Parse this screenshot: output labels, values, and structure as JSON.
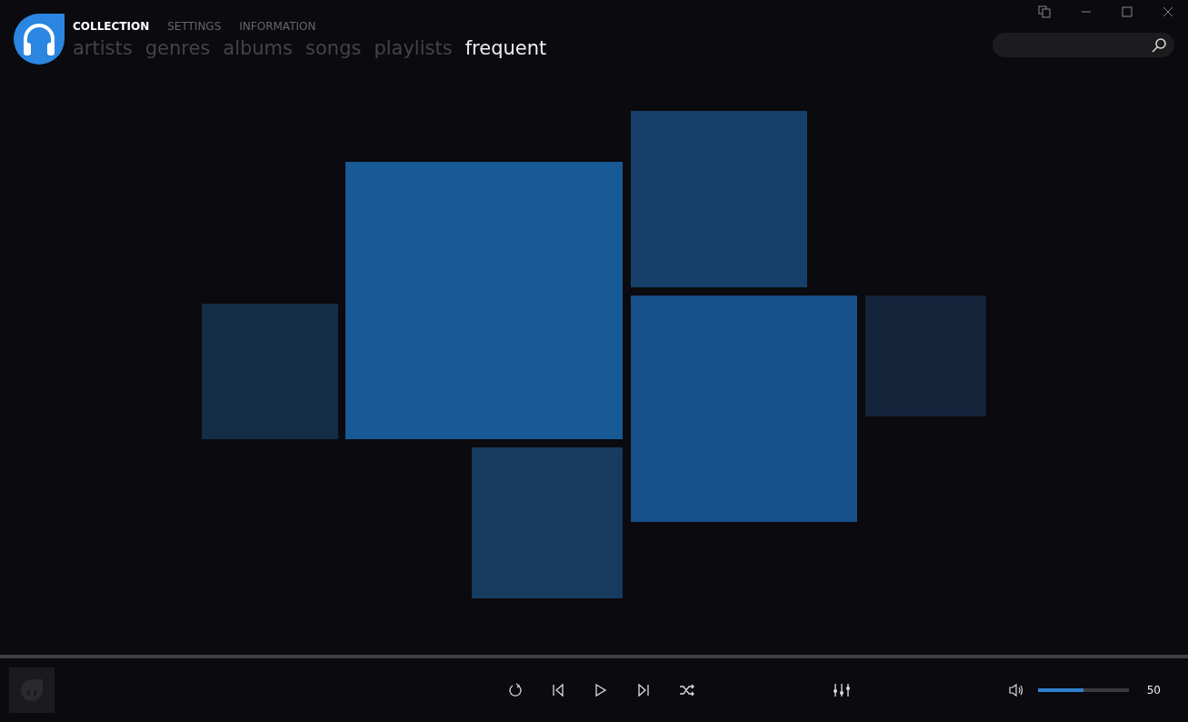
{
  "header": {
    "sections": [
      {
        "label": "COLLECTION",
        "selected": true
      },
      {
        "label": "SETTINGS",
        "selected": false
      },
      {
        "label": "INFORMATION",
        "selected": false
      }
    ],
    "views": [
      {
        "label": "artists",
        "selected": false
      },
      {
        "label": "genres",
        "selected": false
      },
      {
        "label": "albums",
        "selected": false
      },
      {
        "label": "songs",
        "selected": false
      },
      {
        "label": "playlists",
        "selected": false
      },
      {
        "label": "frequent",
        "selected": true
      }
    ]
  },
  "tiles": [
    {
      "color": "#175a96"
    },
    {
      "color": "#163f69"
    },
    {
      "color": "#132d47"
    },
    {
      "color": "#17508a"
    },
    {
      "color": "#13233a"
    },
    {
      "color": "#173a5f"
    }
  ],
  "player": {
    "volume": {
      "level": 0.5,
      "reading": "50"
    }
  }
}
